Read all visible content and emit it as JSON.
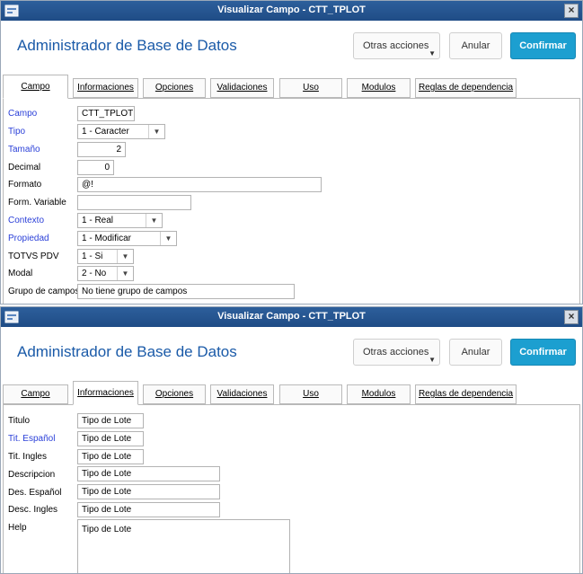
{
  "window1": {
    "title": "Visualizar Campo - CTT_TPLOT",
    "header_title": "Administrador de Base de Datos",
    "buttons": {
      "otras": "Otras acciones",
      "anular": "Anular",
      "confirmar": "Confirmar"
    },
    "tabs": [
      "Campo",
      "Informaciones",
      "Opciones",
      "Validaciones",
      "Uso",
      "Modulos",
      "Reglas de dependencia"
    ],
    "active_tab": "Campo",
    "fields": {
      "campo": {
        "label": "Campo",
        "value": "CTT_TPLOT"
      },
      "tipo": {
        "label": "Tipo",
        "value": "1 - Caracter"
      },
      "tamano": {
        "label": "Tamaño",
        "value": "2"
      },
      "decimal": {
        "label": "Decimal",
        "value": "0"
      },
      "formato": {
        "label": "Formato",
        "value": "@!"
      },
      "form_variable": {
        "label": "Form. Variable",
        "value": ""
      },
      "contexto": {
        "label": "Contexto",
        "value": "1 - Real"
      },
      "propiedad": {
        "label": "Propiedad",
        "value": "1 - Modificar"
      },
      "totvs_pdv": {
        "label": "TOTVS PDV",
        "value": "1 - Si"
      },
      "modal": {
        "label": "Modal",
        "value": "2 - No"
      },
      "grupo_campos": {
        "label": "Grupo de campos",
        "value": "No tiene grupo de campos"
      }
    }
  },
  "window2": {
    "title": "Visualizar Campo - CTT_TPLOT",
    "header_title": "Administrador de Base de Datos",
    "buttons": {
      "otras": "Otras acciones",
      "anular": "Anular",
      "confirmar": "Confirmar"
    },
    "tabs": [
      "Campo",
      "Informaciones",
      "Opciones",
      "Validaciones",
      "Uso",
      "Modulos",
      "Reglas de dependencia"
    ],
    "active_tab": "Informaciones",
    "fields": {
      "titulo": {
        "label": "Titulo",
        "value": "Tipo de Lote"
      },
      "tit_espanol": {
        "label": "Tit. Español",
        "value": "Tipo de Lote"
      },
      "tit_ingles": {
        "label": "Tit. Ingles",
        "value": "Tipo de Lote"
      },
      "descripcion": {
        "label": "Descripcion",
        "value": "Tipo de Lote"
      },
      "des_espanol": {
        "label": "Des. Español",
        "value": "Tipo de Lote"
      },
      "desc_ingles": {
        "label": "Desc. Ingles",
        "value": "Tipo de Lote"
      },
      "help": {
        "label": "Help",
        "value": "Tipo de Lote"
      }
    }
  },
  "colors": {
    "title_bar": "#1f4c86",
    "header_title": "#1a5aa8",
    "confirm_button": "#1c9fd0",
    "required_label": "#2a3fd8"
  },
  "icons": {
    "app": "window-app-icon",
    "close": "close-icon",
    "dropdown": "chevron-down-icon"
  }
}
